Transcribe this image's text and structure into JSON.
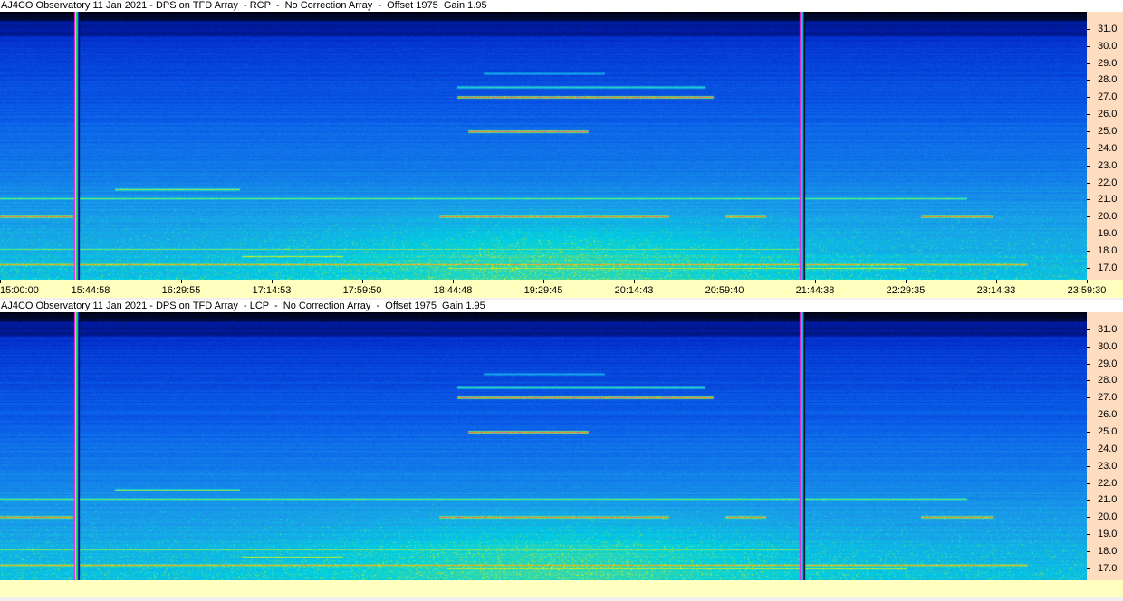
{
  "panels": [
    {
      "title": "AJ4CO Observatory 11 Jan 2021 - DPS on TFD Array  - RCP  -  No Correction Array  -  Offset 1975  Gain 1.95",
      "show_time_labels": true
    },
    {
      "title": "AJ4CO Observatory 11 Jan 2021 - DPS on TFD Array  - LCP  -  No Correction Array  -  Offset 1975  Gain 1.95",
      "show_time_labels": false
    }
  ],
  "chart_data": {
    "type": "heatmap",
    "xlabel": "",
    "ylabel": "",
    "x_range": [
      "15:00:00",
      "23:59:30"
    ],
    "x_tick_labels": [
      "15:00:00",
      "15:44:58",
      "16:29:55",
      "17:14:53",
      "17:59:50",
      "18:44:48",
      "19:29:45",
      "20:14:43",
      "20:59:40",
      "21:44:38",
      "22:29:35",
      "23:14:33",
      "23:59:30"
    ],
    "y_range": [
      16.3,
      32.0
    ],
    "y_tick_labels": [
      "31.0",
      "30.0",
      "29.0",
      "28.0",
      "27.0",
      "26.0",
      "25.0",
      "24.0",
      "23.0",
      "22.0",
      "21.0",
      "20.0",
      "19.0",
      "18.0",
      "17.0"
    ],
    "colormap": [
      "#000000",
      "#000c40",
      "#0020c0",
      "#0a5ae8",
      "#1aa0e8",
      "#00d0e0",
      "#60e080",
      "#f0f000",
      "#ff8020",
      "#ff00ff"
    ],
    "features": [
      {
        "freq": 28.4,
        "start": "19:00",
        "end": "20:00",
        "level": 0.62
      },
      {
        "freq": 27.6,
        "start": "18:47",
        "end": "20:50",
        "level": 0.72
      },
      {
        "freq": 27.0,
        "start": "18:47",
        "end": "20:54",
        "level": 0.97
      },
      {
        "freq": 25.0,
        "start": "18:52",
        "end": "19:52",
        "level": 0.97
      },
      {
        "freq": 21.6,
        "start": "15:57",
        "end": "16:59",
        "level": 0.82
      },
      {
        "freq": 21.1,
        "start": "15:00",
        "end": "23:00",
        "level": 0.8
      },
      {
        "freq": 20.0,
        "start": "15:00",
        "end": "15:36",
        "level": 0.96
      },
      {
        "freq": 20.0,
        "start": "18:38",
        "end": "20:32",
        "level": 0.96
      },
      {
        "freq": 20.0,
        "start": "21:00",
        "end": "21:20",
        "level": 0.95
      },
      {
        "freq": 20.0,
        "start": "22:37",
        "end": "23:13",
        "level": 0.95
      },
      {
        "freq": 18.1,
        "start": "15:00",
        "end": "21:40",
        "level": 0.8
      },
      {
        "freq": 17.7,
        "start": "17:00",
        "end": "17:50",
        "level": 0.85
      },
      {
        "freq": 17.2,
        "start": "15:00",
        "end": "23:30",
        "level": 0.93
      },
      {
        "freq": 17.0,
        "start": "18:42",
        "end": "22:30",
        "level": 0.85
      }
    ],
    "interference_columns": [
      "15:37",
      "21:37"
    ],
    "grid": false
  }
}
